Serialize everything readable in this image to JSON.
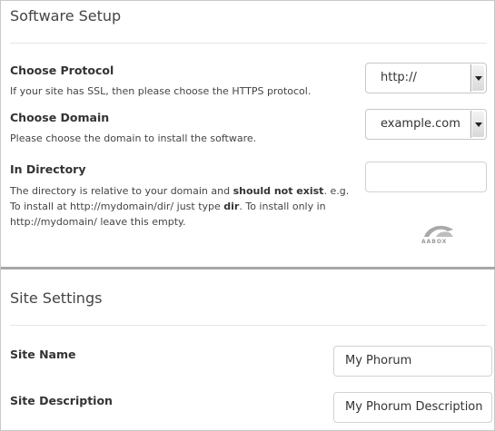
{
  "software_setup": {
    "title": "Software Setup",
    "protocol": {
      "label": "Choose Protocol",
      "help": "If your site has SSL, then please choose the HTTPS protocol.",
      "selected": "http://"
    },
    "domain": {
      "label": "Choose Domain",
      "help": "Please choose the domain to install the software.",
      "selected": "example.com"
    },
    "directory": {
      "label": "In Directory",
      "help_part1": "The directory is relative to your domain and ",
      "help_bold1": "should not exist",
      "help_part2": ". e.g. To install at http://mydomain/dir/ just type ",
      "help_bold2": "dir",
      "help_part3": ". To install only in http://mydomain/ leave this empty.",
      "value": ""
    },
    "logo_text": "AABOX"
  },
  "site_settings": {
    "title": "Site Settings",
    "site_name": {
      "label": "Site Name",
      "value": "My Phorum"
    },
    "site_description": {
      "label": "Site Description",
      "value": "My Phorum Description"
    }
  }
}
